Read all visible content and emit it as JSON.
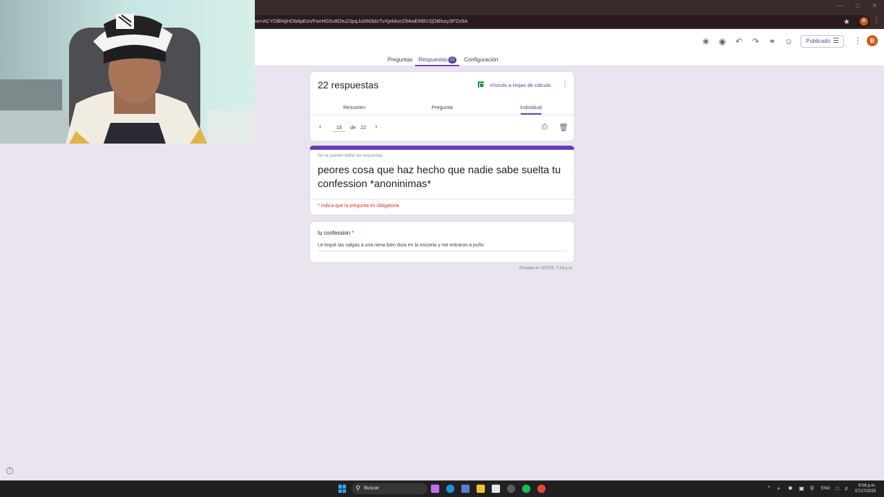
{
  "browser": {
    "url": "se=ACYDBNijHOb8pEoVFwrHG5v8Otu23pqJul3N3dzTvXjekbvrZ94wERBV2jOBlszy3PZs9A"
  },
  "header": {
    "publish_label": "Publicado",
    "avatar_letter": "B",
    "tabs": [
      {
        "label": "Preguntas"
      },
      {
        "label": "Respuestas",
        "count": "22"
      },
      {
        "label": "Configuración"
      }
    ]
  },
  "responses": {
    "title": "22 respuestas",
    "sheets_link": "Vínculo a Hojas de cálculo",
    "subtabs": [
      "Resumen",
      "Pregunta",
      "Individual"
    ],
    "current": "15",
    "of_label": "de",
    "total": "22"
  },
  "form": {
    "note": "No se pueden editar las respuestas",
    "title": "peores cosa que haz hecho que nadie sabe suelta tu confession *anoninimas*",
    "required_note": "* Indica que la pregunta es obligatoria"
  },
  "question": {
    "label": "tu confession",
    "required_mark": "*",
    "answer": "Le toqué las nalgas a una nena bien dura en la escuela y me entraron a puño"
  },
  "sent_label": "Enviado el 15/7/25, 7:18 p.m.",
  "taskbar": {
    "search_label": "Buscar",
    "lang": "ENG",
    "time": "9:08 p.m.",
    "date": "07/17/2025"
  }
}
